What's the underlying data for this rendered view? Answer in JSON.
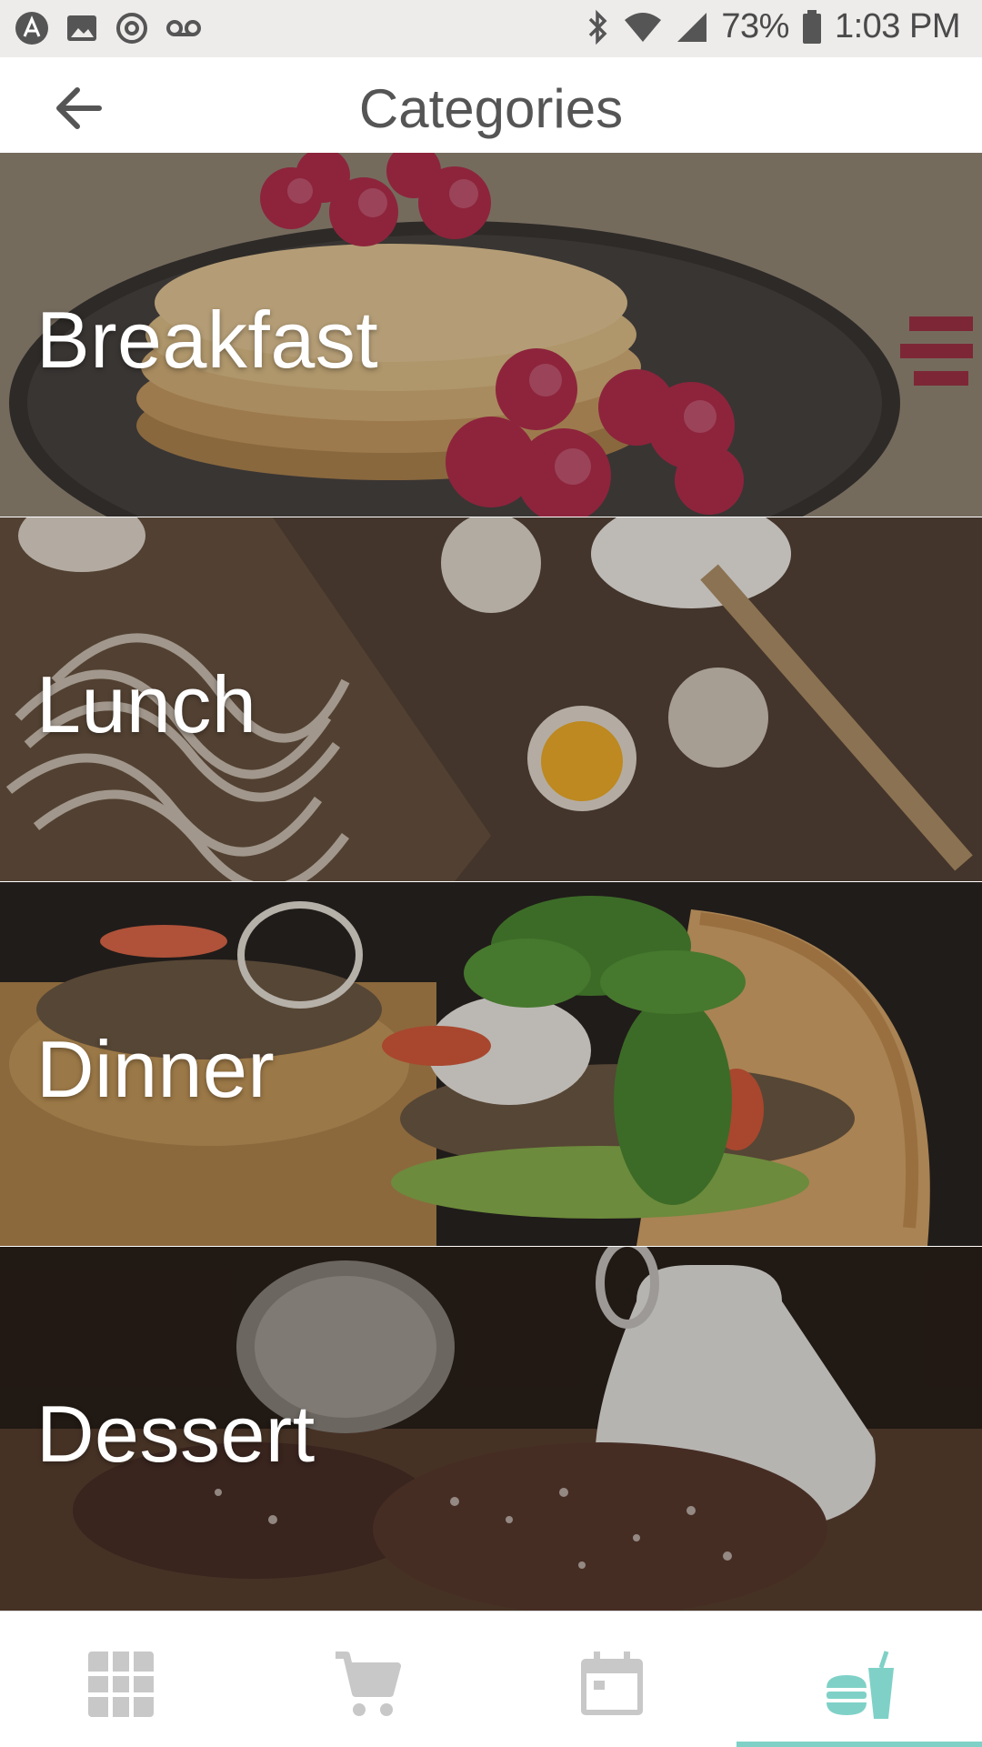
{
  "status_bar": {
    "left_icons": [
      "app-icon",
      "image-icon",
      "sync-icon",
      "voicemail-icon"
    ],
    "right_icons": [
      "bluetooth-icon",
      "wifi-icon",
      "signal-icon",
      "battery-icon"
    ],
    "battery": "73%",
    "time": "1:03 PM"
  },
  "app_bar": {
    "back_icon": "arrow-left-icon",
    "title": "Categories"
  },
  "categories": [
    {
      "label": "Breakfast"
    },
    {
      "label": "Lunch"
    },
    {
      "label": "Dinner"
    },
    {
      "label": "Dessert"
    }
  ],
  "bottom_nav": {
    "items": [
      {
        "icon": "grid-icon",
        "active": false
      },
      {
        "icon": "cart-icon",
        "active": false
      },
      {
        "icon": "calendar-icon",
        "active": false
      },
      {
        "icon": "meal-icon",
        "active": true
      }
    ],
    "active_color": "#7fd1c7",
    "inactive_color": "#c8c8c8"
  }
}
